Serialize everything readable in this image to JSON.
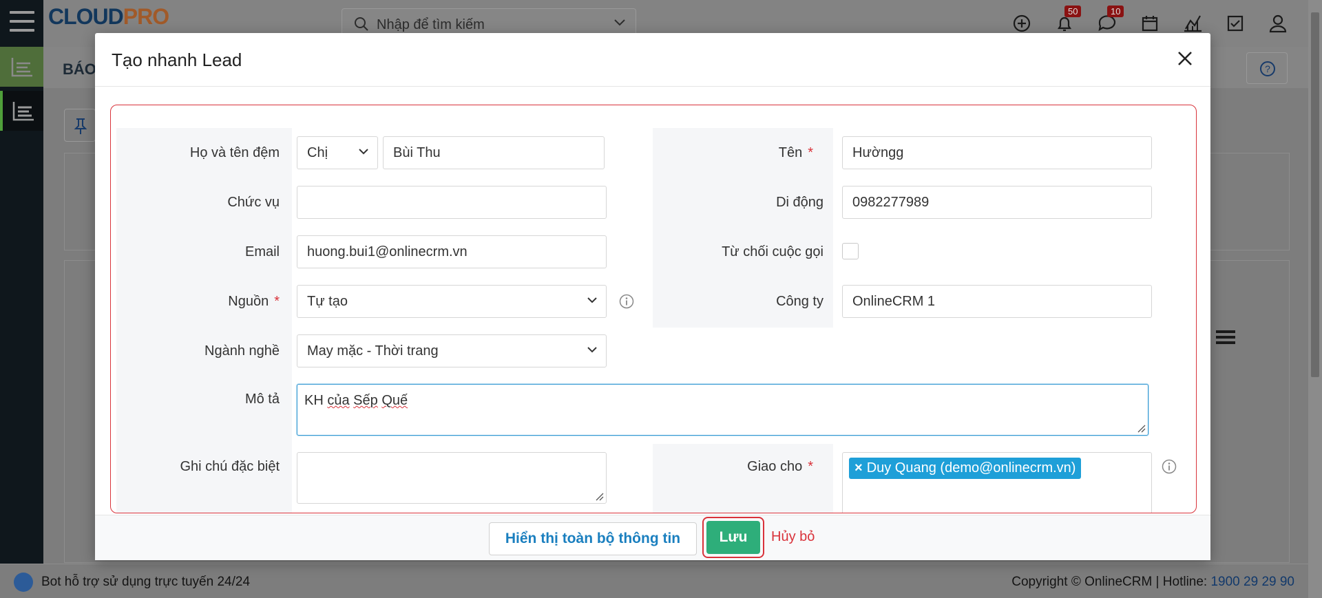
{
  "app": {
    "logo_main": "CLOUD",
    "logo_accent": "PRO",
    "search_placeholder": "Nhập để tìm kiếm",
    "notifications_count": "50",
    "messages_count": "10",
    "page_title": "BÁO"
  },
  "modal": {
    "title": "Tạo nhanh Lead",
    "fields": {
      "full_name_label": "Họ và tên đệm",
      "salutation_value": "Chị",
      "middle_name_value": "Bùi Thu",
      "first_name_label": "Tên",
      "first_name_value": "Hườngg",
      "title_label": "Chức vụ",
      "title_value": "",
      "mobile_label": "Di động",
      "mobile_value": "0982277989",
      "email_label": "Email",
      "email_value": "huong.bui1@onlinecrm.vn",
      "do_not_call_label": "Từ chối cuộc gọi",
      "source_label": "Nguồn",
      "source_value": "Tự tạo",
      "company_label": "Công ty",
      "company_value": "OnlineCRM 1",
      "industry_label": "Ngành nghề",
      "industry_value": "May mặc - Thời trang",
      "description_label": "Mô tả",
      "description_value_1": "KH",
      "description_value_2": "của",
      "description_value_3": "Sếp",
      "description_value_4": "Quế",
      "special_note_label": "Ghi chú đặc biệt",
      "assigned_label": "Giao cho",
      "assigned_tag": "Duy Quang (demo@onlinecrm.vn)",
      "required_mark": "*"
    },
    "buttons": {
      "show_all": "Hiển thị toàn bộ thông tin",
      "save": "Lưu",
      "cancel": "Hủy bỏ"
    }
  },
  "footer": {
    "bot_text": "Bot hỗ trợ sử dụng trực tuyến 24/24",
    "copyright": "Copyright © OnlineCRM | Hotline: ",
    "hotline": "1900 29 29 90"
  },
  "colors": {
    "accent_red": "#d9323a",
    "save_green": "#2eae7a",
    "link_blue": "#1a7fbf",
    "tag_blue": "#1e9fd8"
  }
}
